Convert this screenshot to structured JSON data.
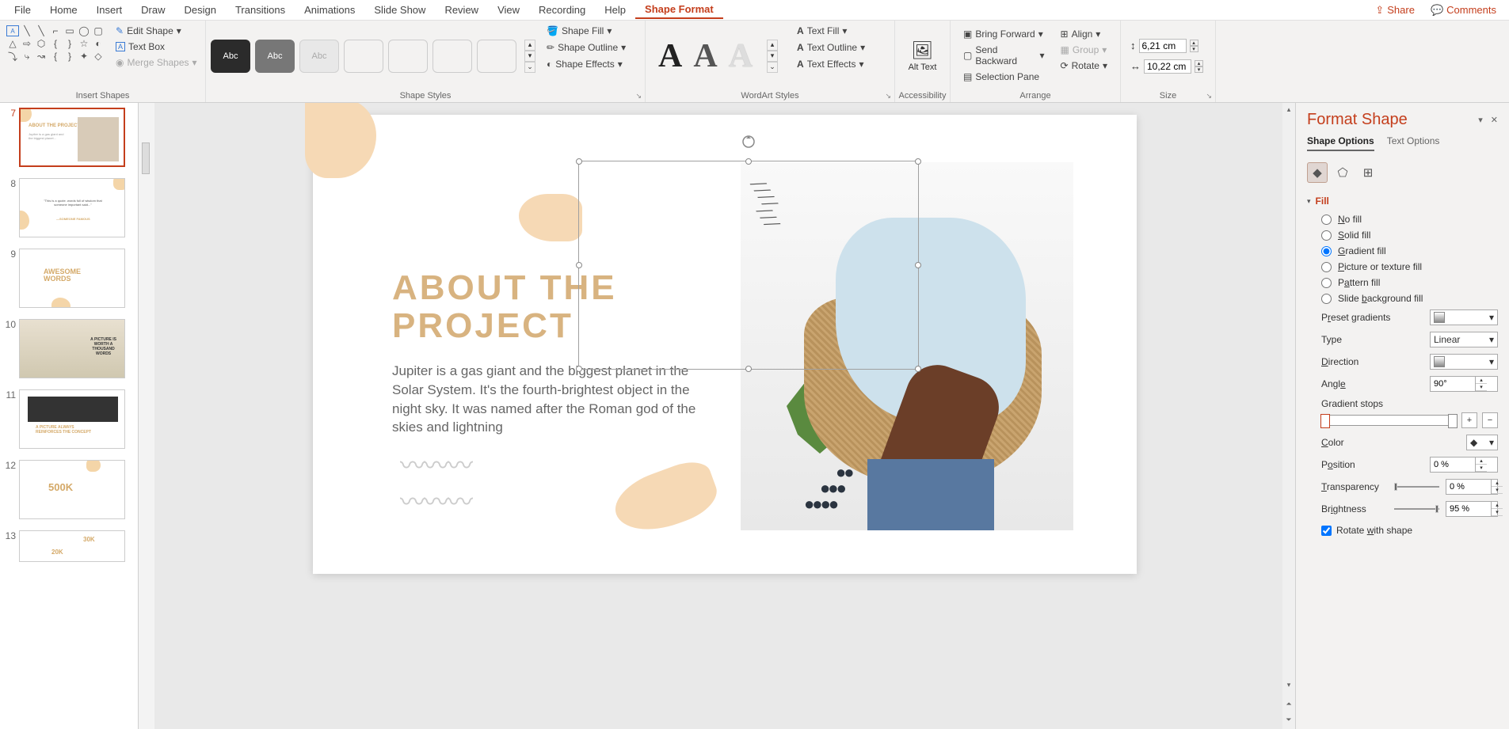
{
  "menubar": {
    "items": [
      "File",
      "Home",
      "Insert",
      "Draw",
      "Design",
      "Transitions",
      "Animations",
      "Slide Show",
      "Review",
      "View",
      "Recording",
      "Help",
      "Shape Format"
    ],
    "active": "Shape Format",
    "share": "Share",
    "comments": "Comments"
  },
  "ribbon": {
    "insert_shapes_label": "Insert Shapes",
    "edit_shape": "Edit Shape",
    "text_box": "Text Box",
    "merge_shapes": "Merge Shapes",
    "shape_styles_label": "Shape Styles",
    "style_sample": "Abc",
    "shape_fill": "Shape Fill",
    "shape_outline": "Shape Outline",
    "shape_effects": "Shape Effects",
    "wordart_label": "WordArt Styles",
    "wordart_sample": "A",
    "text_fill": "Text Fill",
    "text_outline": "Text Outline",
    "text_effects": "Text Effects",
    "accessibility_label": "Accessibility",
    "alt_text": "Alt Text",
    "arrange_label": "Arrange",
    "bring_forward": "Bring Forward",
    "send_backward": "Send Backward",
    "selection_pane": "Selection Pane",
    "align": "Align",
    "group": "Group",
    "rotate": "Rotate",
    "size_label": "Size",
    "height": "6,21 cm",
    "width": "10,22 cm"
  },
  "thumbs": [
    {
      "num": "7",
      "title": "ABOUT THE PROJECT"
    },
    {
      "num": "8",
      "title": "\"This is a quote...\""
    },
    {
      "num": "9",
      "title": "AWESOME WORDS"
    },
    {
      "num": "10",
      "title": "A PICTURE IS WORTH A THOUSAND WORDS"
    },
    {
      "num": "11",
      "title": "A PICTURE ALWAYS REINFORCES THE CONCEPT"
    },
    {
      "num": "12",
      "title": "500K"
    },
    {
      "num": "13",
      "title": "30K"
    }
  ],
  "slide": {
    "title_l1": "ABOUT THE",
    "title_l2": "PROJECT",
    "body": "Jupiter is a gas giant and the biggest planet in the Solar System. It's the fourth-brightest object in the night sky. It was named after the Roman god of the skies and lightning",
    "wavy1": "〰〰〰",
    "wavy2": "〰〰〰"
  },
  "pane": {
    "title": "Format Shape",
    "tab_shape": "Shape Options",
    "tab_text": "Text Options",
    "section_fill": "Fill",
    "no_fill": "No fill",
    "solid_fill": "Solid fill",
    "gradient_fill": "Gradient fill",
    "picture_fill": "Picture or texture fill",
    "pattern_fill": "Pattern fill",
    "slide_bg_fill": "Slide background fill",
    "preset": "Preset gradients",
    "type": "Type",
    "type_val": "Linear",
    "direction": "Direction",
    "angle": "Angle",
    "angle_val": "90°",
    "stops": "Gradient stops",
    "color": "Color",
    "position": "Position",
    "position_val": "0 %",
    "transparency": "Transparency",
    "transparency_val": "0 %",
    "brightness": "Brightness",
    "brightness_val": "95 %",
    "rotate_with": "Rotate with shape"
  }
}
